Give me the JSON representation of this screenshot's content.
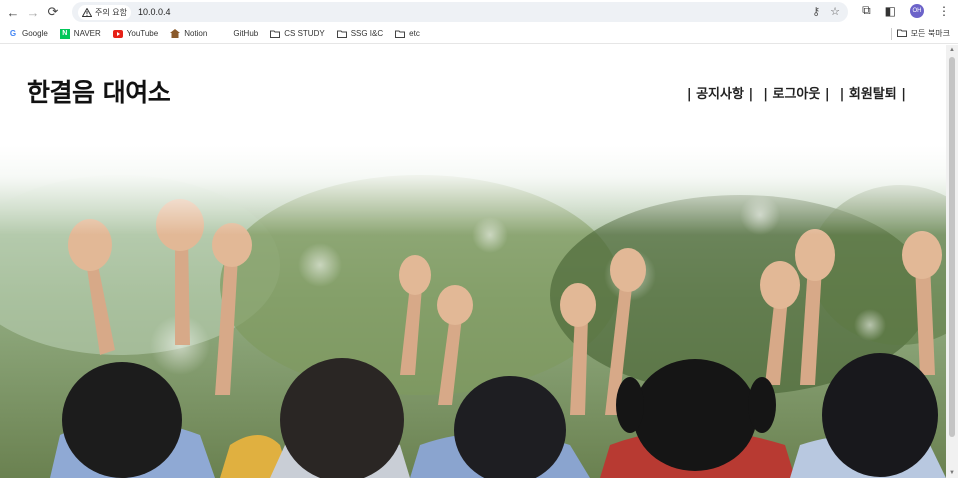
{
  "browser": {
    "url": "10.0.0.4",
    "security_label": "주의 요함",
    "profile_initials": "OH",
    "all_bookmarks": "모든 북마크"
  },
  "bookmarks": [
    {
      "label": "Google",
      "icon": "google-icon",
      "color": "#4285f4"
    },
    {
      "label": "NAVER",
      "icon": "naver-icon",
      "color": "#03c75a"
    },
    {
      "label": "YouTube",
      "icon": "youtube-icon",
      "color": "#e62117"
    },
    {
      "label": "Notion",
      "icon": "notion-house-icon",
      "color": "#8a5a2b"
    },
    {
      "label": "GitHub",
      "icon": "",
      "color": "#333333"
    },
    {
      "label": "CS STUDY",
      "icon": "folder-icon",
      "color": "#444444"
    },
    {
      "label": "SSG I&C",
      "icon": "folder-icon",
      "color": "#444444"
    },
    {
      "label": "etc",
      "icon": "folder-icon",
      "color": "#444444"
    }
  ],
  "site": {
    "logo": "한결음 대여소",
    "nav": [
      {
        "label": "| 공지사항 |"
      },
      {
        "label": "| 로그아웃 |"
      },
      {
        "label": "| 회원탈퇴 |"
      }
    ],
    "hero_image": "children-raising-hands-photo"
  }
}
